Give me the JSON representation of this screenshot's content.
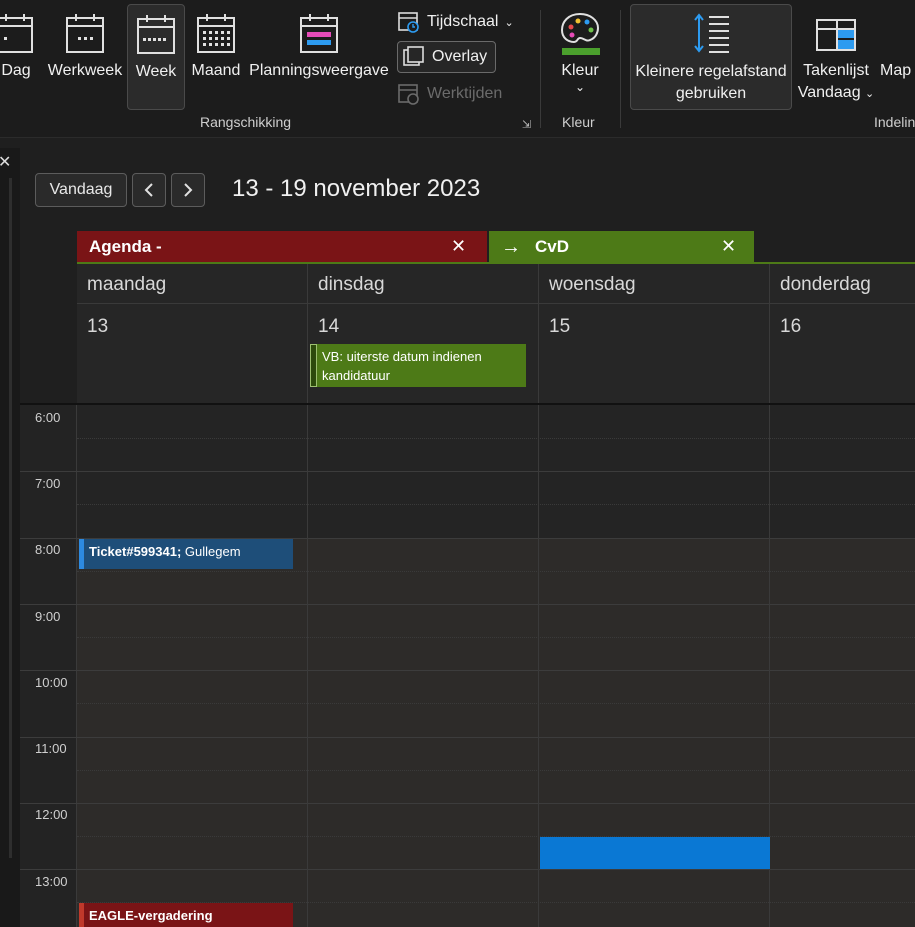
{
  "ribbon": {
    "views": [
      {
        "label": "Dag"
      },
      {
        "label": "Werkweek"
      },
      {
        "label": "Week"
      },
      {
        "label": "Maand"
      },
      {
        "label": "Planningsweergave"
      }
    ],
    "time_scale": "Tijdschaal",
    "overlay": "Overlay",
    "work_hours": "Werktijden",
    "group_arrange": "Rangschikking",
    "color_label": "Kleur",
    "group_color": "Kleur",
    "spacing_line1": "Kleinere regelafstand",
    "spacing_line2": "gebruiken",
    "tasklist_line1": "Takenlijst",
    "tasklist_line2": "Vandaag",
    "map_label": "Map",
    "group_layout": "Indelin"
  },
  "header": {
    "today_label": "Vandaag",
    "date_range": "13 - 19 november 2023"
  },
  "calendars": [
    {
      "label": "Agenda -",
      "color": "#7a1416"
    },
    {
      "label": "CvD",
      "color": "#4d7a17"
    }
  ],
  "days": [
    {
      "name": "maandag",
      "num": "13"
    },
    {
      "name": "dinsdag",
      "num": "14"
    },
    {
      "name": "woensdag",
      "num": "15"
    },
    {
      "name": "donderdag",
      "num": "16"
    }
  ],
  "times": [
    "6:00",
    "7:00",
    "8:00",
    "9:00",
    "10:00",
    "11:00",
    "12:00",
    "13:00"
  ],
  "events": {
    "allday_tue": {
      "text": "VB: uiterste datum indienen kandidatuur",
      "color": "#4d7a17"
    },
    "ticket": {
      "bold": "Ticket#599341;",
      "rest": " Gullegem",
      "color": "#1e4e79"
    },
    "blue_block": {
      "color": "#0a78d4"
    },
    "eagle": {
      "bold": "EAGLE-vergadering",
      "color": "#7a1416"
    }
  }
}
